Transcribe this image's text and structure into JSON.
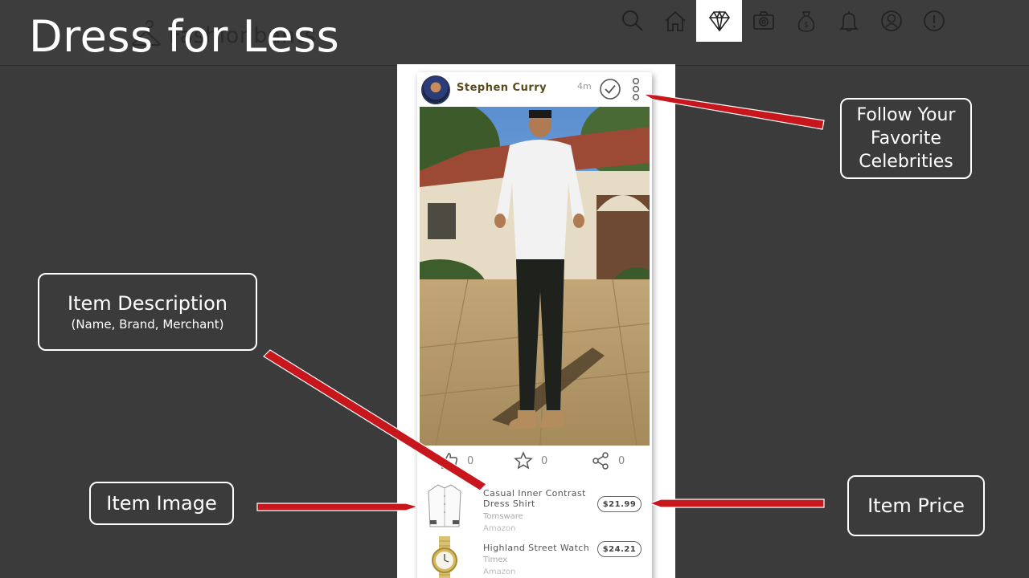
{
  "slide": {
    "title": "Dress for Less"
  },
  "app": {
    "brand_name": "Fashionbants"
  },
  "nav": [
    {
      "icon": "search-icon"
    },
    {
      "icon": "home-icon"
    },
    {
      "icon": "diamond-icon",
      "active": true
    },
    {
      "icon": "camera-icon"
    },
    {
      "icon": "money-bag-icon"
    },
    {
      "icon": "bell-icon"
    },
    {
      "icon": "profile-icon"
    },
    {
      "icon": "alert-icon"
    }
  ],
  "post": {
    "username": "Stephen Curry",
    "time": "4m",
    "likes": "0",
    "favorites": "0",
    "shares": "0"
  },
  "items": [
    {
      "name": "Casual Inner Contrast Dress Shirt",
      "brand": "Tomsware",
      "merchant": "Amazon",
      "price": "$21.99"
    },
    {
      "name": "Highland Street Watch",
      "brand": "Timex",
      "merchant": "Amazon",
      "price": "$24.21"
    }
  ],
  "callouts": {
    "follow": "Follow Your Favorite Celebrities",
    "description_title": "Item Description",
    "description_sub": "(Name, Brand, Merchant)",
    "image": "Item Image",
    "price": "Item Price"
  },
  "colors": {
    "accent_arrow": "#c8161d",
    "background": "#3b3b3b"
  }
}
